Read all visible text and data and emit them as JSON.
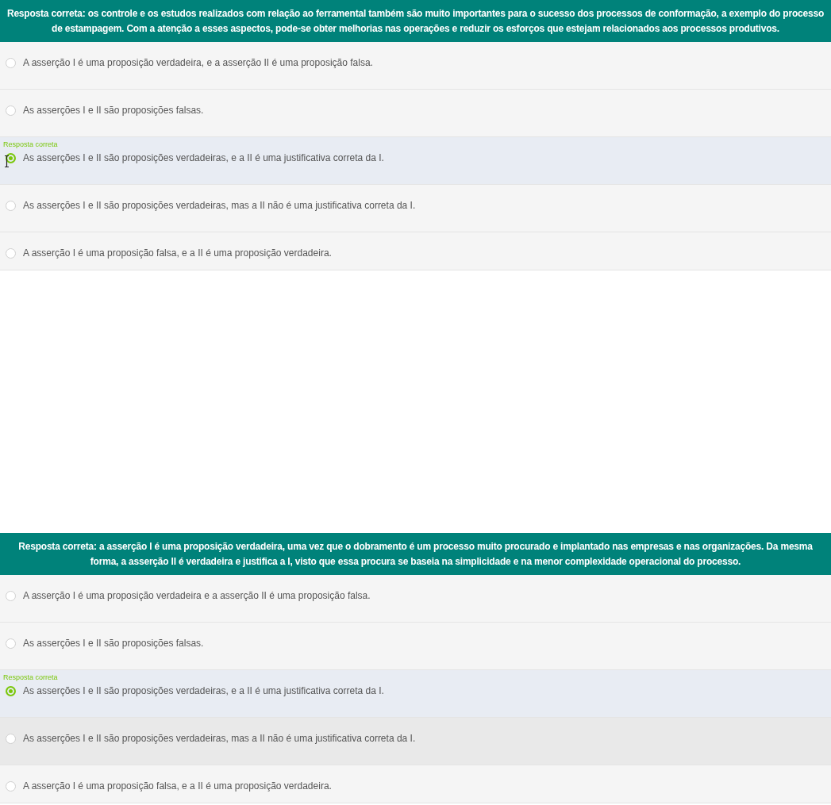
{
  "questions": [
    {
      "feedback": "Resposta correta: os controle e os estudos realizados com relação ao ferramental também são muito importantes para o sucesso dos processos de conformação, a exemplo do processo de estampagem. Com a atenção a esses aspectos, pode-se obter melhorias nas operações e reduzir os esforços que estejam relacionados aos processos produtivos.",
      "options": [
        {
          "text": "A asserção I é uma proposição verdadeira, e a asserção II é uma proposição falsa.",
          "selected": false,
          "hovered": false,
          "cursor": false
        },
        {
          "text": "As asserções I e II são proposições falsas.",
          "selected": false,
          "hovered": false,
          "cursor": false
        },
        {
          "text": "As asserções I e II são proposições verdadeiras, e a II é uma justificativa correta da I.",
          "selected": true,
          "hovered": false,
          "cursor": true,
          "correct_label": "Resposta correta"
        },
        {
          "text": "As asserções I e II são proposições verdadeiras, mas a II não é uma justificativa correta da I.",
          "selected": false,
          "hovered": false,
          "cursor": false
        },
        {
          "text": "A asserção I é uma proposição falsa, e a II é uma proposição verdadeira.",
          "selected": false,
          "hovered": false,
          "cursor": false
        }
      ]
    },
    {
      "feedback": "Resposta correta: a asserção I é uma proposição verdadeira, uma vez que o dobramento é um processo muito procurado e implantado nas empresas e nas organizações. Da mesma forma, a asserção II é verdadeira e justifica a I, visto que essa procura se baseia na simplicidade e na menor complexidade operacional do processo.",
      "options": [
        {
          "text": "A asserção I é uma proposição verdadeira e a asserção II é uma proposição falsa.",
          "selected": false,
          "hovered": false,
          "cursor": false
        },
        {
          "text": "As asserções I e II são proposições falsas.",
          "selected": false,
          "hovered": false,
          "cursor": false
        },
        {
          "text": "As asserções I e II são proposições verdadeiras, e a II é uma justificativa correta da I.",
          "selected": true,
          "hovered": false,
          "cursor": false,
          "correct_label": "Resposta correta"
        },
        {
          "text": "As asserções I e II são proposições verdadeiras, mas a II não é uma justificativa correta da I.",
          "selected": false,
          "hovered": true,
          "cursor": false
        },
        {
          "text": "A asserção I é uma proposição falsa, e a II é uma proposição verdadeira.",
          "selected": false,
          "hovered": false,
          "cursor": false
        }
      ]
    }
  ]
}
